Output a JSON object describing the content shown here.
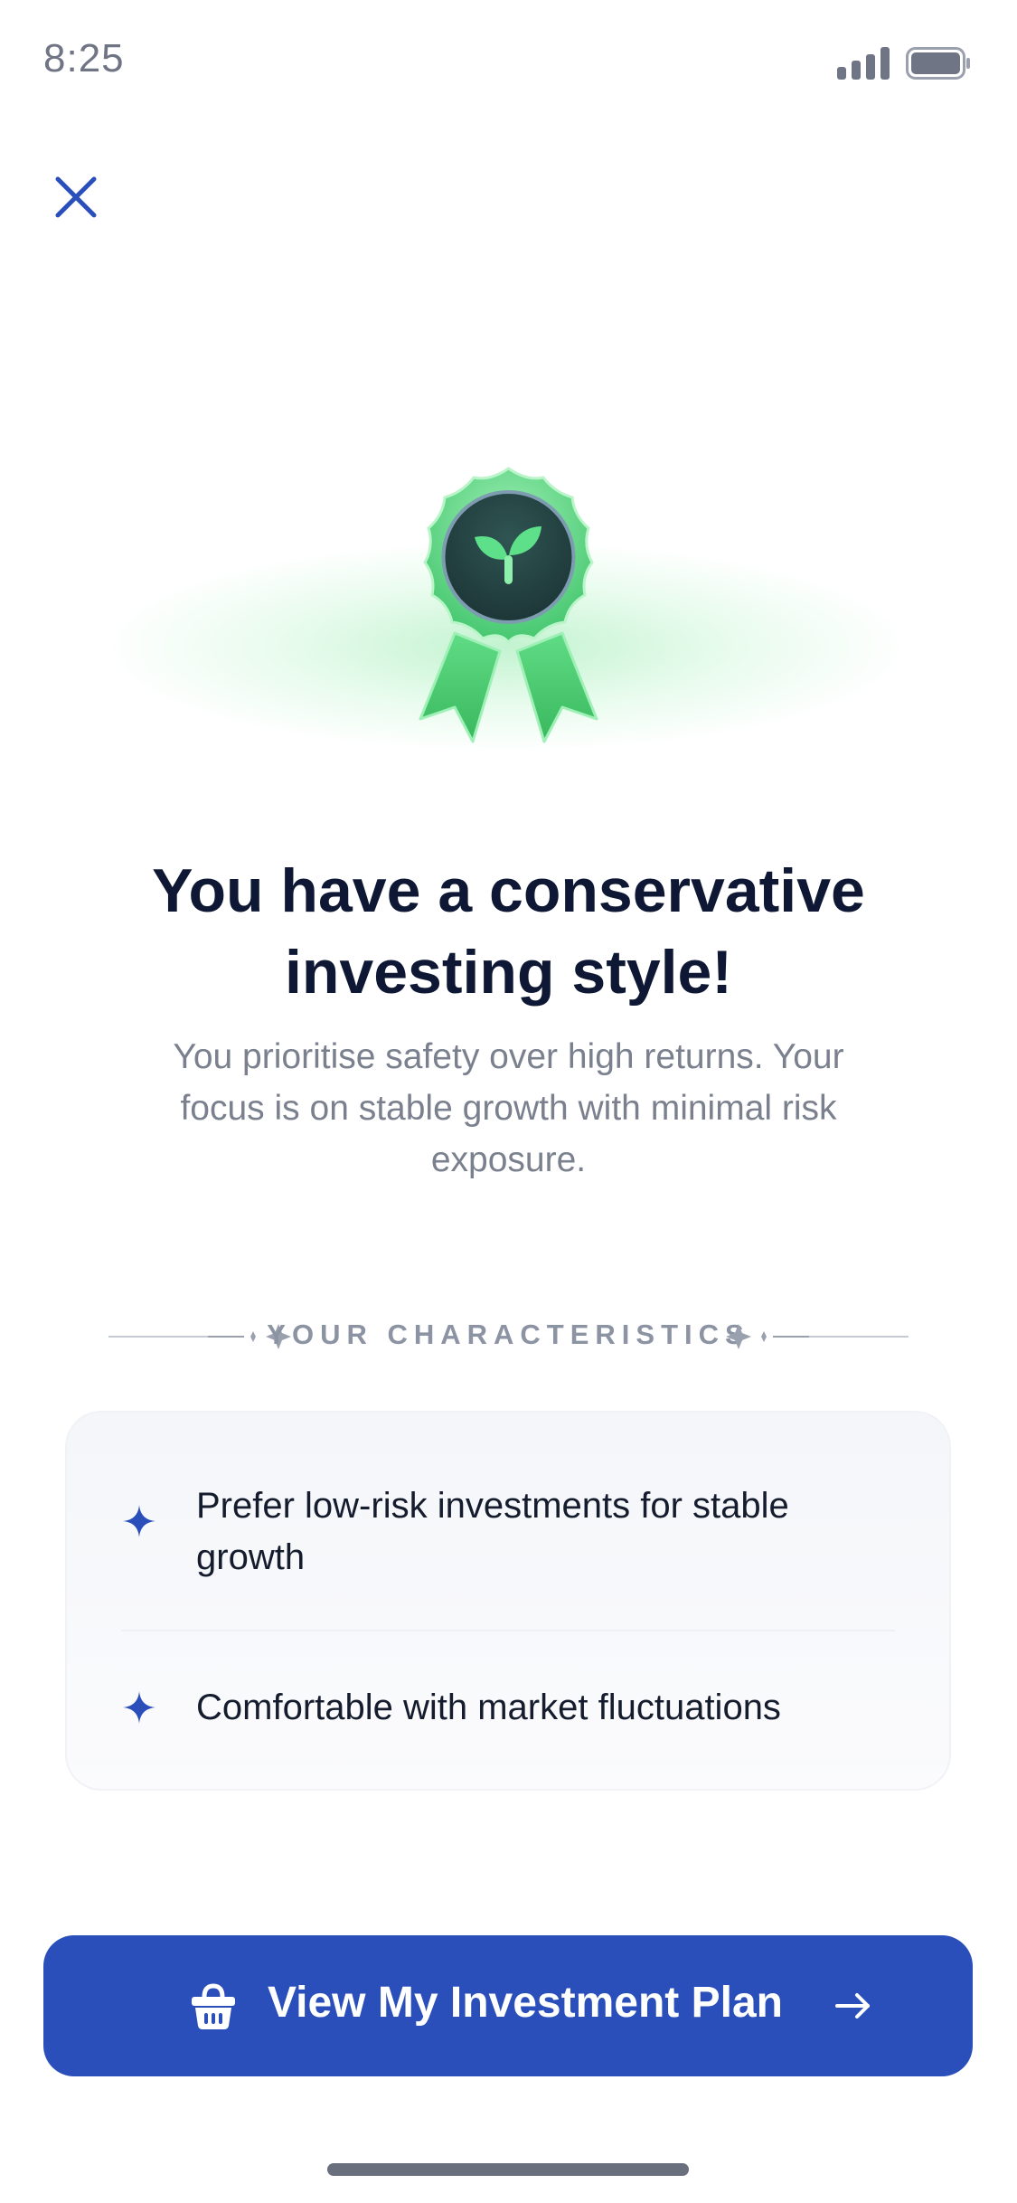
{
  "status_bar": {
    "time": "8:25",
    "signal_icon": "cellular-signal-icon",
    "battery_icon": "battery-icon"
  },
  "header": {
    "close_icon": "close-icon"
  },
  "hero": {
    "badge_icon": "award-ribbon-sprout-icon",
    "title": "You have a conservative investing style!",
    "subtitle": "You prioritise safety over high returns. Your focus is on stable growth with minimal risk exposure."
  },
  "characteristics": {
    "heading": "YOUR CHARACTERISTICS",
    "items": [
      {
        "icon": "sparkle-icon",
        "text": "Prefer low-risk investments for stable growth"
      },
      {
        "icon": "sparkle-icon",
        "text": "Comfortable with market fluctuations"
      }
    ]
  },
  "cta": {
    "label": "View My Investment Plan",
    "icon": "basket-icon",
    "arrow_icon": "arrow-right-icon"
  },
  "colors": {
    "primary": "#2a4fbb",
    "accent_green": "#3fc46a",
    "text_dark": "#0e1834",
    "text_muted": "#7a808d"
  }
}
